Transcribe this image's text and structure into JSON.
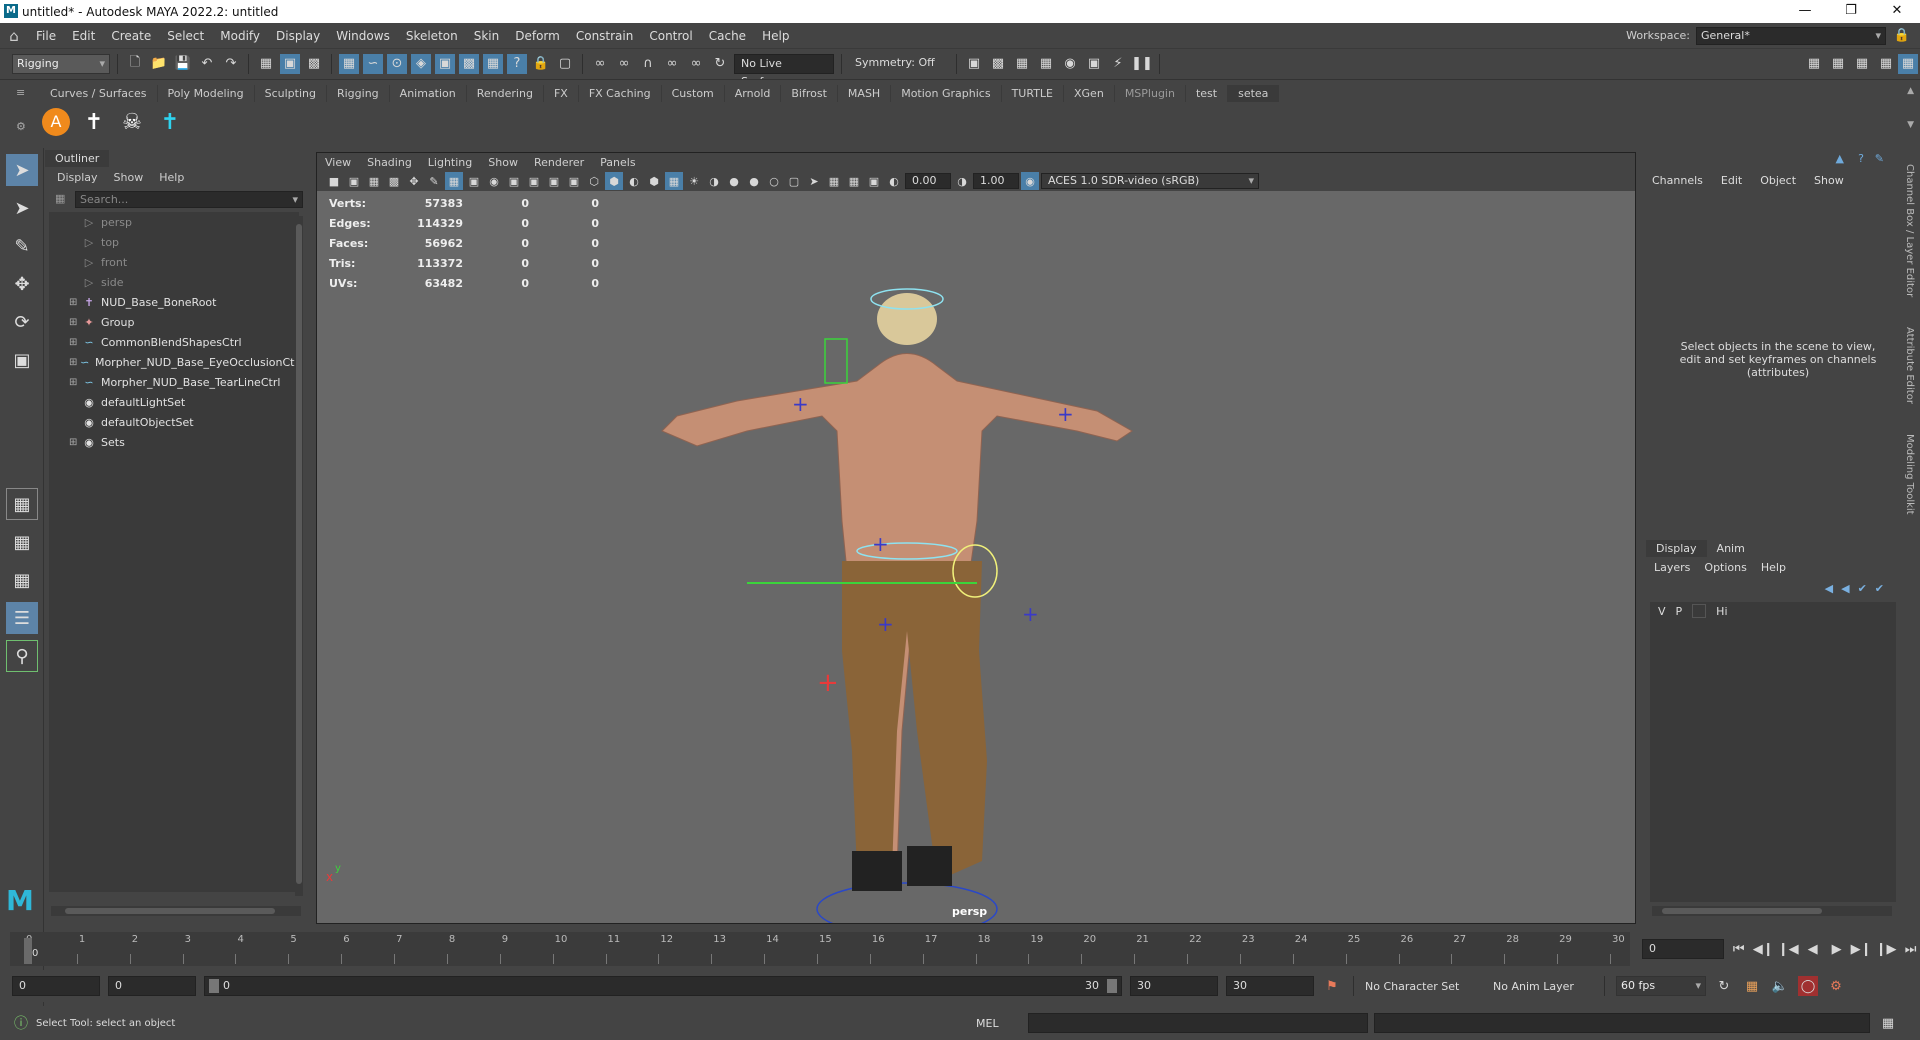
{
  "window": {
    "title": "untitled* - Autodesk MAYA 2022.2: untitled"
  },
  "menubar": [
    "File",
    "Edit",
    "Create",
    "Select",
    "Modify",
    "Display",
    "Windows",
    "Skeleton",
    "Skin",
    "Deform",
    "Constrain",
    "Control",
    "Cache",
    "Help"
  ],
  "workspace": {
    "label": "Workspace:",
    "value": "General*"
  },
  "statusline": {
    "mode": "Rigging",
    "live_surface": "No Live Surface",
    "symmetry": "Symmetry: Off"
  },
  "shelf": {
    "tabs": [
      "Curves / Surfaces",
      "Poly Modeling",
      "Sculpting",
      "Rigging",
      "Animation",
      "Rendering",
      "FX",
      "FX Caching",
      "Custom",
      "Arnold",
      "Bifrost",
      "MASH",
      "Motion Graphics",
      "TURTLE",
      "XGen",
      "MSPlugin",
      "test",
      "setea"
    ],
    "icon_letter": "A"
  },
  "outliner": {
    "tab": "Outliner",
    "menu": [
      "Display",
      "Show",
      "Help"
    ],
    "search_placeholder": "Search...",
    "items": [
      {
        "label": "persp",
        "dim": true
      },
      {
        "label": "top",
        "dim": true
      },
      {
        "label": "front",
        "dim": true
      },
      {
        "label": "side",
        "dim": true
      },
      {
        "label": "NUD_Base_BoneRoot",
        "dim": false
      },
      {
        "label": "Group",
        "dim": false
      },
      {
        "label": "CommonBlendShapesCtrl",
        "dim": false
      },
      {
        "label": "Morpher_NUD_Base_EyeOcclusionCtr",
        "dim": false
      },
      {
        "label": "Morpher_NUD_Base_TearLineCtrl",
        "dim": false
      },
      {
        "label": "defaultLightSet",
        "dim": false
      },
      {
        "label": "defaultObjectSet",
        "dim": false
      },
      {
        "label": "Sets",
        "dim": false
      }
    ]
  },
  "viewport": {
    "menu": [
      "View",
      "Shading",
      "Lighting",
      "Show",
      "Renderer",
      "Panels"
    ],
    "exposure": "0.00",
    "gamma": "1.00",
    "color_space": "ACES 1.0 SDR-video (sRGB)",
    "camera": "persp",
    "hud": [
      {
        "label": "Verts:",
        "v": "57383",
        "a": "0",
        "b": "0"
      },
      {
        "label": "Edges:",
        "v": "114329",
        "a": "0",
        "b": "0"
      },
      {
        "label": "Faces:",
        "v": "56962",
        "a": "0",
        "b": "0"
      },
      {
        "label": "Tris:",
        "v": "113372",
        "a": "0",
        "b": "0"
      },
      {
        "label": "UVs:",
        "v": "63482",
        "a": "0",
        "b": "0"
      }
    ]
  },
  "channelbox": {
    "menu": [
      "Channels",
      "Edit",
      "Object",
      "Show"
    ],
    "message": "Select objects in the scene to view, edit and set keyframes on channels (attributes)",
    "side_tabs": [
      "Channel Box / Layer Editor",
      "Attribute Editor",
      "Modeling Toolkit"
    ]
  },
  "layers": {
    "tabs": [
      "Display",
      "Anim"
    ],
    "menu": [
      "Layers",
      "Options",
      "Help"
    ],
    "row": {
      "v": "V",
      "p": "P",
      "name": "Hi"
    }
  },
  "timeline": {
    "ticks": [
      "0",
      "1",
      "2",
      "3",
      "4",
      "5",
      "6",
      "7",
      "8",
      "9",
      "10",
      "11",
      "12",
      "13",
      "14",
      "15",
      "16",
      "17",
      "18",
      "19",
      "20",
      "21",
      "22",
      "23",
      "24",
      "25",
      "26",
      "27",
      "28",
      "29",
      "30"
    ],
    "current_frame": "0",
    "current": "0"
  },
  "range": {
    "start": "0",
    "anim_start": "0",
    "slider_start": "0",
    "slider_end": "30",
    "end": "30",
    "anim_end": "30",
    "character_set": "No Character Set",
    "anim_layer": "No Anim Layer",
    "fps": "60 fps"
  },
  "cmdline": {
    "lang": "MEL",
    "help": "Select Tool: select an object"
  }
}
